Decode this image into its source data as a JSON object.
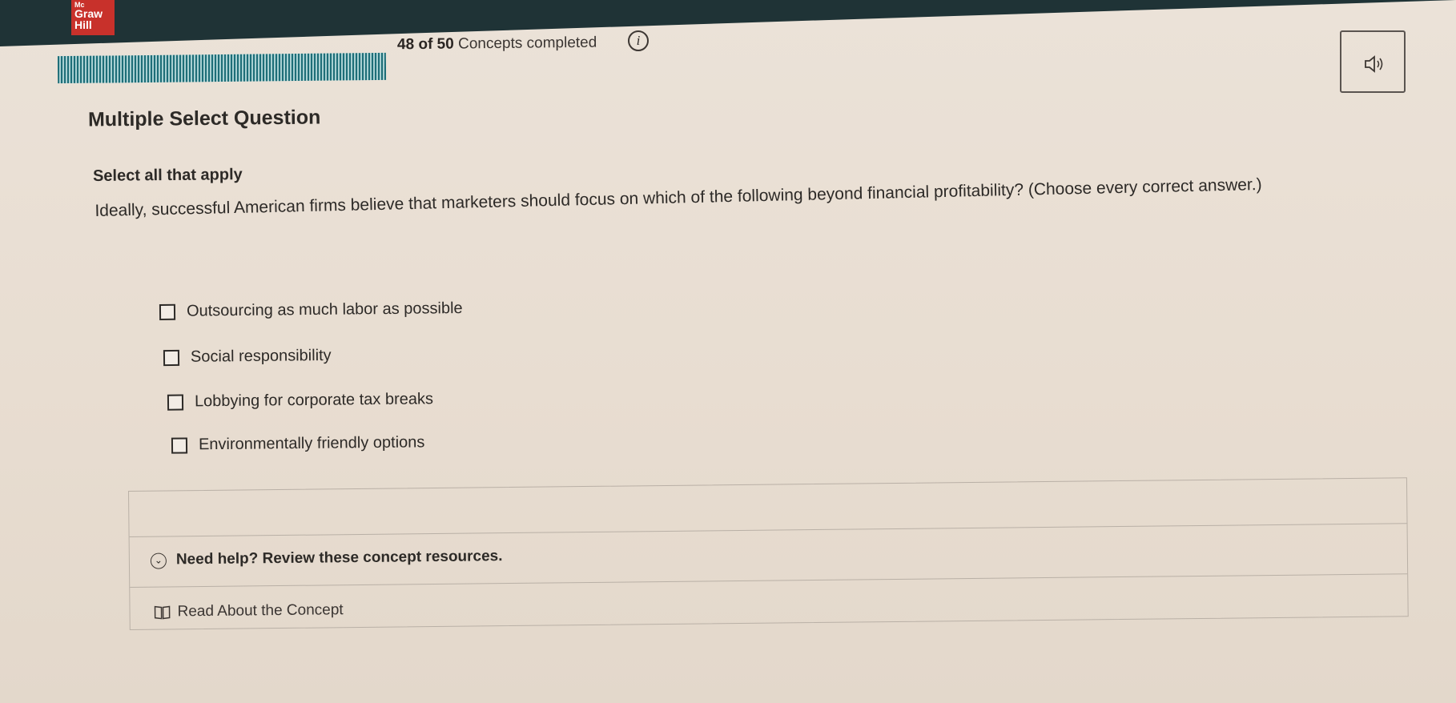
{
  "logo": {
    "line1": "Mc",
    "line2": "Graw",
    "line3": "Hill",
    "color": "#c8312b"
  },
  "progress": {
    "completed": 48,
    "total": 50,
    "count_text": "48 of 50",
    "label_text": "Concepts completed",
    "bar_color": "#1e6e78",
    "fraction": 0.96
  },
  "icons": {
    "info": "info-icon",
    "audio": "speaker-icon",
    "expand": "chevron-down-icon",
    "book": "book-icon"
  },
  "question": {
    "type": "Multiple Select Question",
    "instruction": "Select all that apply",
    "prompt": "Ideally, successful American firms believe that marketers should focus on which of the following beyond financial profitability? (Choose every correct answer.)",
    "choices": [
      {
        "label": "Outsourcing as much labor as possible",
        "checked": false
      },
      {
        "label": "Social responsibility",
        "checked": false
      },
      {
        "label": "Lobbying for corporate tax breaks",
        "checked": false
      },
      {
        "label": "Environmentally friendly options",
        "checked": false
      }
    ]
  },
  "help": {
    "heading": "Need help? Review these concept resources.",
    "links": [
      {
        "label": "Read About the Concept"
      }
    ]
  }
}
